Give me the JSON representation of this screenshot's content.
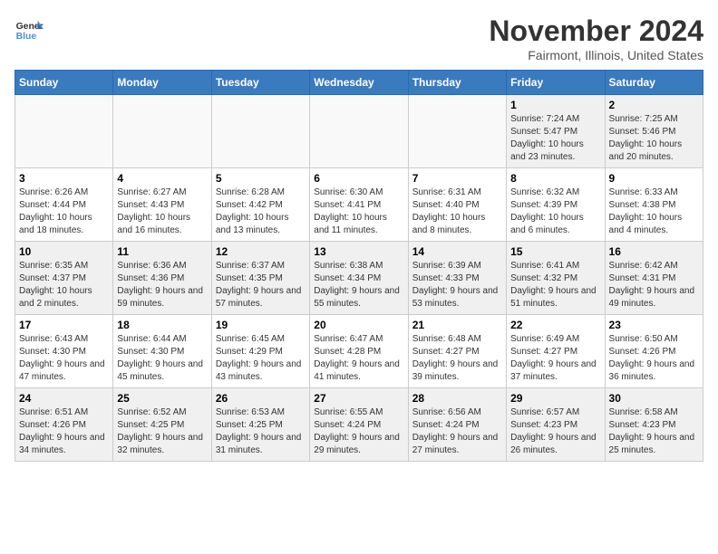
{
  "logo": {
    "general": "General",
    "blue": "Blue"
  },
  "title": "November 2024",
  "location": "Fairmont, Illinois, United States",
  "days_of_week": [
    "Sunday",
    "Monday",
    "Tuesday",
    "Wednesday",
    "Thursday",
    "Friday",
    "Saturday"
  ],
  "weeks": [
    [
      {
        "day": "",
        "info": ""
      },
      {
        "day": "",
        "info": ""
      },
      {
        "day": "",
        "info": ""
      },
      {
        "day": "",
        "info": ""
      },
      {
        "day": "",
        "info": ""
      },
      {
        "day": "1",
        "info": "Sunrise: 7:24 AM\nSunset: 5:47 PM\nDaylight: 10 hours and 23 minutes."
      },
      {
        "day": "2",
        "info": "Sunrise: 7:25 AM\nSunset: 5:46 PM\nDaylight: 10 hours and 20 minutes."
      }
    ],
    [
      {
        "day": "3",
        "info": "Sunrise: 6:26 AM\nSunset: 4:44 PM\nDaylight: 10 hours and 18 minutes."
      },
      {
        "day": "4",
        "info": "Sunrise: 6:27 AM\nSunset: 4:43 PM\nDaylight: 10 hours and 16 minutes."
      },
      {
        "day": "5",
        "info": "Sunrise: 6:28 AM\nSunset: 4:42 PM\nDaylight: 10 hours and 13 minutes."
      },
      {
        "day": "6",
        "info": "Sunrise: 6:30 AM\nSunset: 4:41 PM\nDaylight: 10 hours and 11 minutes."
      },
      {
        "day": "7",
        "info": "Sunrise: 6:31 AM\nSunset: 4:40 PM\nDaylight: 10 hours and 8 minutes."
      },
      {
        "day": "8",
        "info": "Sunrise: 6:32 AM\nSunset: 4:39 PM\nDaylight: 10 hours and 6 minutes."
      },
      {
        "day": "9",
        "info": "Sunrise: 6:33 AM\nSunset: 4:38 PM\nDaylight: 10 hours and 4 minutes."
      }
    ],
    [
      {
        "day": "10",
        "info": "Sunrise: 6:35 AM\nSunset: 4:37 PM\nDaylight: 10 hours and 2 minutes."
      },
      {
        "day": "11",
        "info": "Sunrise: 6:36 AM\nSunset: 4:36 PM\nDaylight: 9 hours and 59 minutes."
      },
      {
        "day": "12",
        "info": "Sunrise: 6:37 AM\nSunset: 4:35 PM\nDaylight: 9 hours and 57 minutes."
      },
      {
        "day": "13",
        "info": "Sunrise: 6:38 AM\nSunset: 4:34 PM\nDaylight: 9 hours and 55 minutes."
      },
      {
        "day": "14",
        "info": "Sunrise: 6:39 AM\nSunset: 4:33 PM\nDaylight: 9 hours and 53 minutes."
      },
      {
        "day": "15",
        "info": "Sunrise: 6:41 AM\nSunset: 4:32 PM\nDaylight: 9 hours and 51 minutes."
      },
      {
        "day": "16",
        "info": "Sunrise: 6:42 AM\nSunset: 4:31 PM\nDaylight: 9 hours and 49 minutes."
      }
    ],
    [
      {
        "day": "17",
        "info": "Sunrise: 6:43 AM\nSunset: 4:30 PM\nDaylight: 9 hours and 47 minutes."
      },
      {
        "day": "18",
        "info": "Sunrise: 6:44 AM\nSunset: 4:30 PM\nDaylight: 9 hours and 45 minutes."
      },
      {
        "day": "19",
        "info": "Sunrise: 6:45 AM\nSunset: 4:29 PM\nDaylight: 9 hours and 43 minutes."
      },
      {
        "day": "20",
        "info": "Sunrise: 6:47 AM\nSunset: 4:28 PM\nDaylight: 9 hours and 41 minutes."
      },
      {
        "day": "21",
        "info": "Sunrise: 6:48 AM\nSunset: 4:27 PM\nDaylight: 9 hours and 39 minutes."
      },
      {
        "day": "22",
        "info": "Sunrise: 6:49 AM\nSunset: 4:27 PM\nDaylight: 9 hours and 37 minutes."
      },
      {
        "day": "23",
        "info": "Sunrise: 6:50 AM\nSunset: 4:26 PM\nDaylight: 9 hours and 36 minutes."
      }
    ],
    [
      {
        "day": "24",
        "info": "Sunrise: 6:51 AM\nSunset: 4:26 PM\nDaylight: 9 hours and 34 minutes."
      },
      {
        "day": "25",
        "info": "Sunrise: 6:52 AM\nSunset: 4:25 PM\nDaylight: 9 hours and 32 minutes."
      },
      {
        "day": "26",
        "info": "Sunrise: 6:53 AM\nSunset: 4:25 PM\nDaylight: 9 hours and 31 minutes."
      },
      {
        "day": "27",
        "info": "Sunrise: 6:55 AM\nSunset: 4:24 PM\nDaylight: 9 hours and 29 minutes."
      },
      {
        "day": "28",
        "info": "Sunrise: 6:56 AM\nSunset: 4:24 PM\nDaylight: 9 hours and 27 minutes."
      },
      {
        "day": "29",
        "info": "Sunrise: 6:57 AM\nSunset: 4:23 PM\nDaylight: 9 hours and 26 minutes."
      },
      {
        "day": "30",
        "info": "Sunrise: 6:58 AM\nSunset: 4:23 PM\nDaylight: 9 hours and 25 minutes."
      }
    ]
  ]
}
